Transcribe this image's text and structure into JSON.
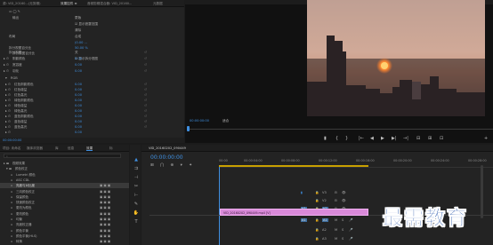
{
  "top_tabs": [
    "源: VID_20160...(无剪辑)",
    "效果控件 ≡",
    "音频剪辑混合器: VID_20160...",
    "元数据"
  ],
  "effect_controls": {
    "top_rows": [
      {
        "label": "",
        "value": "▭ ◯ ✎"
      },
      {
        "label": "输出",
        "value": "蒙版"
      },
      {
        "label": "",
        "value": "☑ 显示遮罩范围"
      },
      {
        "label": "",
        "value": "清除"
      },
      {
        "label": "布局",
        "value": "合成"
      },
      {
        "label": "",
        "value": "(0.00 ..."
      },
      {
        "label": "拆分视图百分比",
        "value": "50.00 %"
      },
      {
        "label": "拆分视图百分比",
        "value": ""
      },
      {
        "label": "",
        "value": "☑ 显示拆分视图"
      }
    ],
    "ctrl_rows": [
      {
        "label": "拆分视图",
        "value": "关"
      },
      {
        "label": "阴影颜色",
        "value": "0.00"
      },
      {
        "label": "宽容度",
        "value": "0.00"
      },
      {
        "label": "羽化",
        "value": "0.00"
      },
      {
        "label": "RGB",
        "value": ""
      },
      {
        "label": "红色阴影颜色",
        "value": "0.00"
      },
      {
        "label": "红色增益",
        "value": "0.00"
      },
      {
        "label": "红色高光",
        "value": "0.00"
      },
      {
        "label": "绿色阴影颜色",
        "value": "0.00"
      },
      {
        "label": "绿色增益",
        "value": "0.00"
      },
      {
        "label": "绿色高光",
        "value": "0.00"
      },
      {
        "label": "蓝色阴影颜色",
        "value": "0.00"
      },
      {
        "label": "蓝色增益",
        "value": "0.00"
      },
      {
        "label": "蓝色高光",
        "value": "0.00"
      },
      {
        "label": "",
        "value": "0.00"
      }
    ],
    "timecode": "00:00:00:00"
  },
  "program": {
    "timecode": "00:00:00:00",
    "fit": "适合",
    "transport": [
      "▮",
      "{",
      "}",
      "|←",
      "◀",
      "▶",
      "▶|",
      "→|",
      "⊟",
      "⊞",
      "⊡",
      "+"
    ]
  },
  "project": {
    "tabs": [
      "项目: 未命名",
      "媒体浏览器",
      "库",
      "信息",
      "效果",
      "标"
    ],
    "search": "",
    "items": [
      "视频效果",
      "颜色校正",
      "Lumetri 颜色",
      "ASC CDL",
      "亮度与对比度",
      "三向颜色校正",
      "保留颜色",
      "快速颜色校正",
      "更改为颜色",
      "更改颜色",
      "均衡",
      "亮度校正器",
      "颜色平衡",
      "颜色平衡(HLS)",
      "转换",
      "视频限幅器",
      "通道混合器"
    ]
  },
  "timeline": {
    "tab": "VID_20160202_090449",
    "timecode": "00:00:00:00",
    "ruler": [
      "00:00",
      "00:00:04:00",
      "00:00:08:00",
      "00:00:12:00",
      "00:00:16:00",
      "00:00:20:00",
      "00:00:24:00",
      "00:00:28:00"
    ],
    "tracks": [
      "V3",
      "V2",
      "V1",
      "A1",
      "A2",
      "A3"
    ],
    "clip": "VID_20160202_090449.mp4 [V]"
  },
  "watermark": "最需教育"
}
